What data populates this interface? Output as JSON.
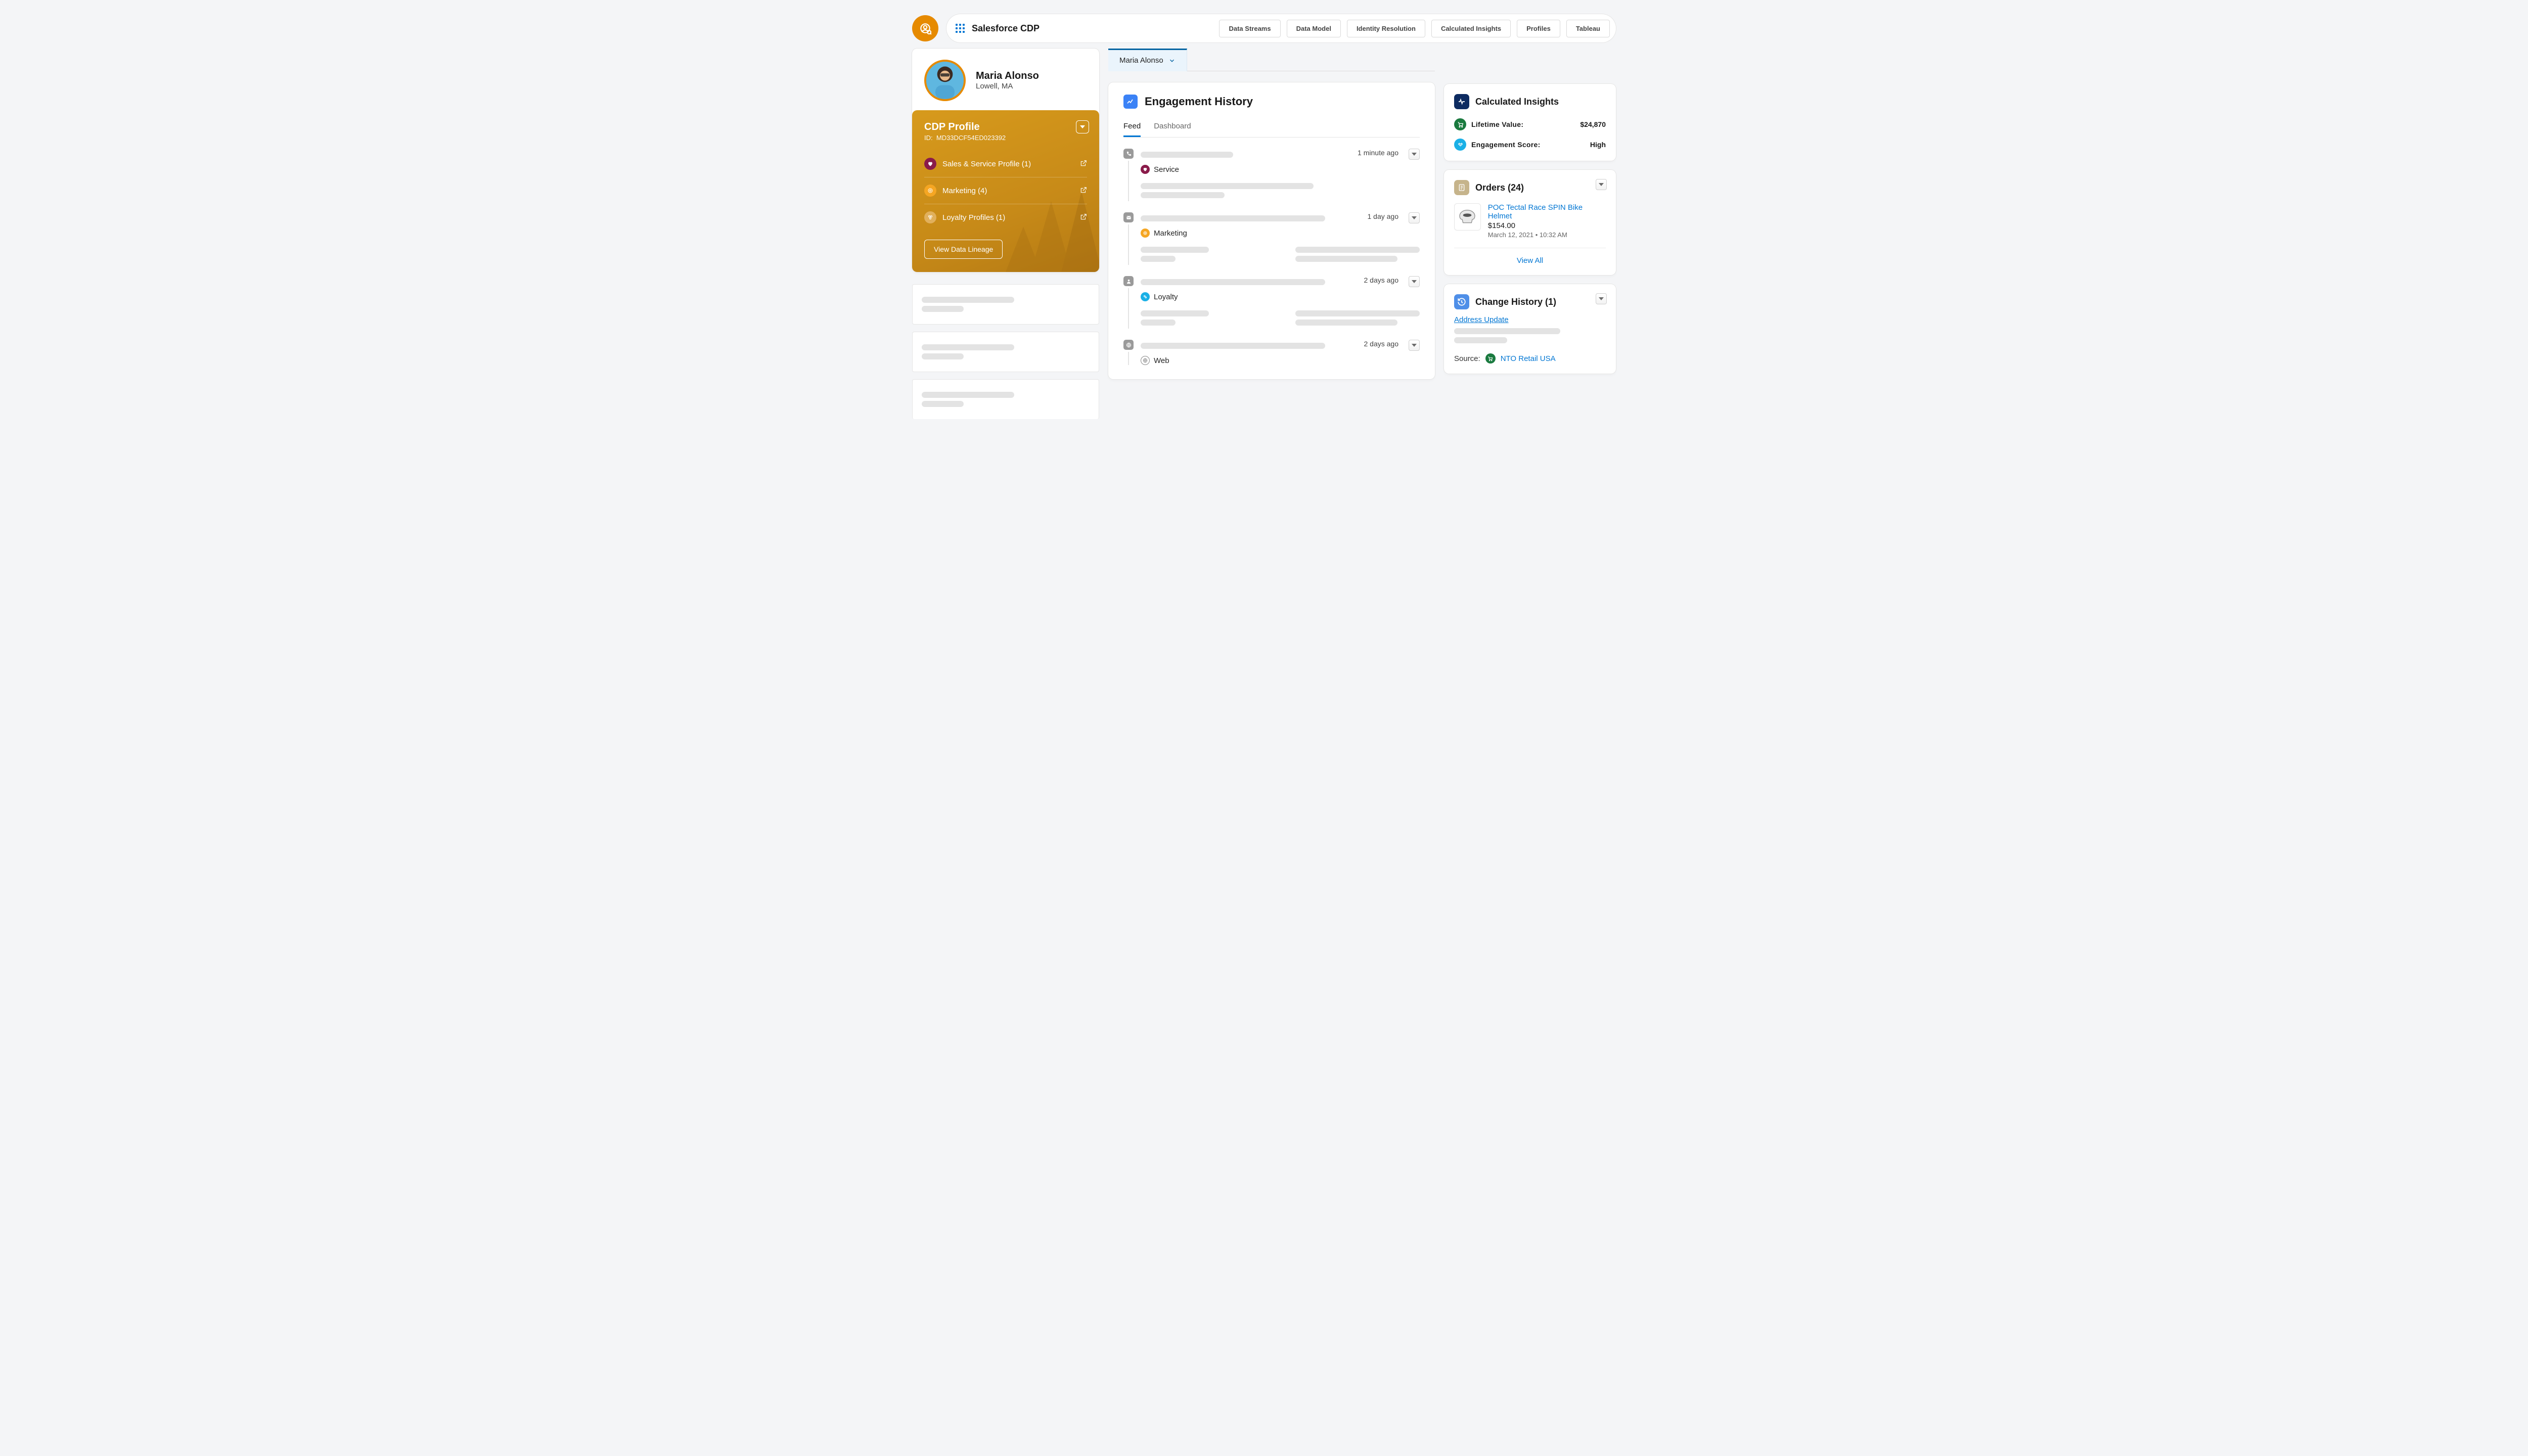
{
  "header": {
    "app_name": "Salesforce CDP",
    "nav": [
      "Data Streams",
      "Data Model",
      "Identity Resolution",
      "Calculated Insights",
      "Profiles",
      "Tableau"
    ]
  },
  "profile": {
    "name": "Maria Alonso",
    "location": "Lowell, MA"
  },
  "cdp": {
    "title": "CDP Profile",
    "id_label": "ID:",
    "id_value": "MD33DCF54ED023392",
    "items": [
      {
        "label": "Sales & Service Profile (1)"
      },
      {
        "label": "Marketing (4)"
      },
      {
        "label": "Loyalty Profiles (1)"
      }
    ],
    "button": "View Data Lineage"
  },
  "active_tab": "Maria Alonso",
  "engagement": {
    "title": "Engagement History",
    "tabs": {
      "feed": "Feed",
      "dashboard": "Dashboard"
    },
    "feed": [
      {
        "tag": "Service",
        "time": "1 minute ago"
      },
      {
        "tag": "Marketing",
        "time": "1 day ago"
      },
      {
        "tag": "Loyalty",
        "time": "2 days ago"
      },
      {
        "tag": "Web",
        "time": "2 days ago"
      }
    ]
  },
  "insights": {
    "title": "Calculated Insights",
    "rows": [
      {
        "label": "Lifetime Value:",
        "value": "$24,870"
      },
      {
        "label": "Engagement Score:",
        "value": "High"
      }
    ]
  },
  "orders": {
    "title": "Orders (24)",
    "item": {
      "name": "POC Tectal Race SPIN Bike Helmet",
      "price": "$154.00",
      "date": "March 12, 2021 • 10:32 AM"
    },
    "view_all": "View All"
  },
  "change_history": {
    "title": "Change History (1)",
    "link": "Address Update",
    "source_label": "Source:",
    "source_value": "NTO Retail USA"
  }
}
